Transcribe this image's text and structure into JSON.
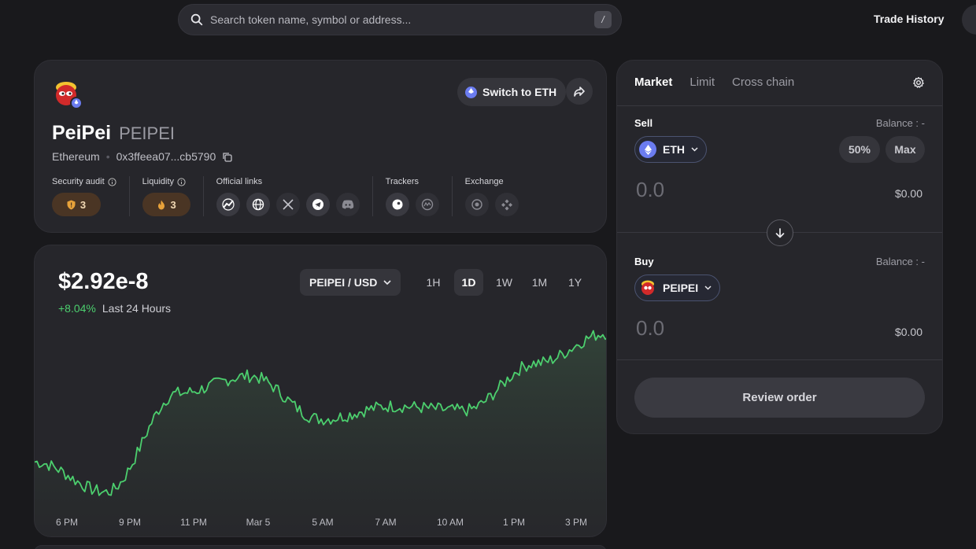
{
  "topbar": {
    "search_placeholder": "Search token name, symbol or address...",
    "search_shortcut": "/",
    "trade_history": "Trade History"
  },
  "token": {
    "name": "PeiPei",
    "symbol": "PEIPEI",
    "chain": "Ethereum",
    "address": "0x3ffeea07...cb5790",
    "switch_label": "Switch to ETH",
    "security_audit_label": "Security audit",
    "security_audit_count": "3",
    "liquidity_label": "Liquidity",
    "liquidity_count": "3",
    "official_links_label": "Official links",
    "trackers_label": "Trackers",
    "exchange_label": "Exchange"
  },
  "chart": {
    "price": "$2.92e-8",
    "change_pct": "+8.04%",
    "change_period": "Last 24 Hours",
    "pair": "PEIPEI / USD",
    "ranges": [
      "1H",
      "1D",
      "1W",
      "1M",
      "1Y"
    ],
    "active_range": "1D",
    "x_labels": [
      "6 PM",
      "9 PM",
      "11 PM",
      "Mar 5",
      "5 AM",
      "7 AM",
      "10 AM",
      "1 PM",
      "3 PM"
    ],
    "line_color": "#4ccf6e"
  },
  "chart_data": {
    "type": "area",
    "x": [
      "6 PM",
      "9 PM",
      "11 PM",
      "Mar 5",
      "5 AM",
      "7 AM",
      "10 AM",
      "1 PM",
      "3 PM"
    ],
    "values": [
      2.62,
      2.55,
      2.78,
      2.82,
      2.72,
      2.75,
      2.74,
      2.85,
      2.92
    ],
    "title": "",
    "xlabel": "",
    "ylabel": ""
  },
  "swap": {
    "tabs": [
      "Market",
      "Limit",
      "Cross chain"
    ],
    "active_tab": "Market",
    "sell_label": "Sell",
    "sell_balance": "Balance : -",
    "sell_token": "ETH",
    "pct_button": "50%",
    "max_button": "Max",
    "sell_amount": "0.0",
    "sell_usd": "$0.00",
    "buy_label": "Buy",
    "buy_balance": "Balance : -",
    "buy_token": "PEIPEI",
    "buy_amount": "0.0",
    "buy_usd": "$0.00",
    "review_label": "Review order"
  }
}
